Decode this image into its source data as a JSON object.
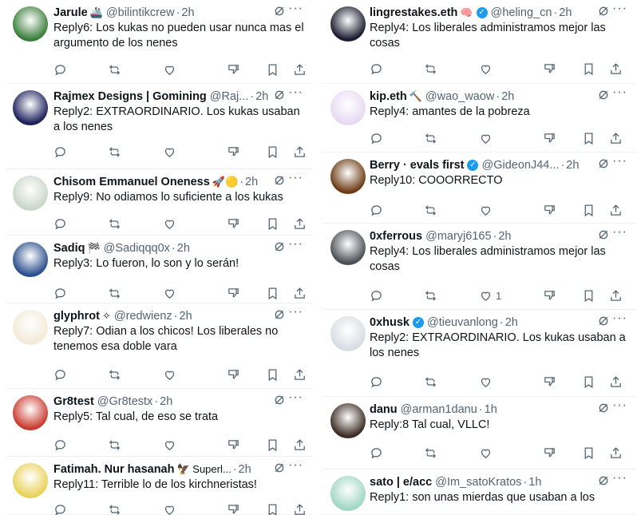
{
  "left": [
    {
      "name": "Jarule",
      "badge": "🚢",
      "handle": "@bilintikcrew",
      "time": "2h",
      "text": "Reply6: Los kukas no pueden usar nunca mas el argumento de los nenes",
      "avatar_color": "#3a7d3a",
      "likes": ""
    },
    {
      "name": "Rajmex Designs | Gomining",
      "badge": "",
      "handle": "@Raj...",
      "time": "2h",
      "text": "Reply2: EXTRAORDINARIO. Los kukas usaban a los nenes",
      "avatar_color": "#1b1f5a",
      "likes": ""
    },
    {
      "name": "Chisom Emmanuel Oneness",
      "badge": "🚀🟡",
      "handle": "",
      "time": "2h",
      "text": "Reply9: No odiamos lo suficiente a los kukas",
      "avatar_color": "#c9d6c9",
      "likes": ""
    },
    {
      "name": "Sadiq",
      "badge": "🏁",
      "handle": "@Sadiqqq0x",
      "time": "2h",
      "text": "Reply3: Lo fueron, lo son y lo serán!",
      "avatar_color": "#2a4e8c",
      "likes": ""
    },
    {
      "name": "glyphrot",
      "badge": "✧",
      "handle": "@redwienz",
      "time": "2h",
      "text": "Reply7: Odian a los chicos! Los liberales no tenemos esa doble vara",
      "avatar_color": "#f3ead8",
      "likes": ""
    },
    {
      "name": "Gr8test",
      "badge": "",
      "handle": "@Gr8testx",
      "time": "2h",
      "text": "Reply5: Tal cual, de eso se trata",
      "avatar_color": "#c93a2e",
      "likes": ""
    },
    {
      "name": "Fatimah. Nur hasanah",
      "badge": "🦅 Superl...",
      "handle": "",
      "time": "2h",
      "text": "Reply11: Terrible lo de los kirchneristas!",
      "avatar_color": "#e9d25a",
      "likes": ""
    }
  ],
  "right": [
    {
      "name": "lingrestakes.eth",
      "badge": "🧠",
      "verified": true,
      "handle": "@heling_cn",
      "time": "2h",
      "text": "Reply4: Los liberales administramos mejor las cosas",
      "avatar_color": "#1a1a2e",
      "likes": ""
    },
    {
      "name": "kip.eth",
      "badge": "🔨",
      "verified": false,
      "handle": "@wao_waow",
      "time": "2h",
      "text": "Reply4: amantes de la pobreza",
      "avatar_color": "#e7d9f2",
      "likes": ""
    },
    {
      "name": "Berry · evals first",
      "badge": "",
      "verified": true,
      "handle": "@GideonJ44...",
      "time": "2h",
      "text": "Reply10: COOORRECTO",
      "avatar_color": "#6b3a12",
      "likes": ""
    },
    {
      "name": "0xferrous",
      "badge": "",
      "verified": false,
      "handle": "@maryj6165",
      "time": "2h",
      "text": "Reply4: Los liberales administramos mejor las cosas",
      "avatar_color": "#4a4f55",
      "likes": "1"
    },
    {
      "name": "0xhusk",
      "badge": "",
      "verified": true,
      "handle": "@tieuvanlong",
      "time": "2h",
      "text": "Reply2: EXTRAORDINARIO. Los kukas usaban a los nenes",
      "avatar_color": "#d8dde3",
      "likes": ""
    },
    {
      "name": "danu",
      "badge": "",
      "verified": false,
      "handle": "@arman1danu",
      "time": "1h",
      "text": "Reply:8 Tal cual, VLLC!",
      "avatar_color": "#3b2a22",
      "likes": ""
    },
    {
      "name": "sato | e/acc",
      "badge": "",
      "verified": false,
      "handle": "@Im_satoKratos",
      "time": "1h",
      "text": "Reply1: son unas mierdas que usaban a los",
      "avatar_color": "#9fd6c4",
      "likes": ""
    }
  ]
}
